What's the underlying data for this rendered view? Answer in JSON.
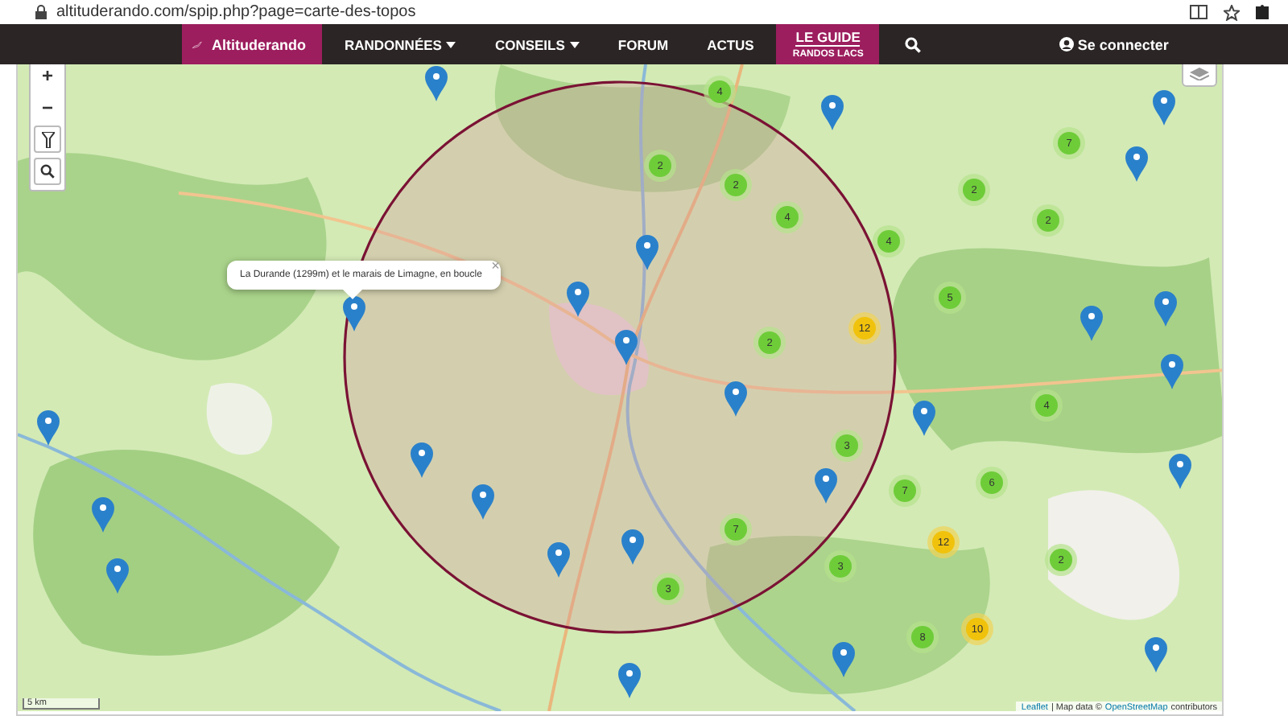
{
  "browser": {
    "url": "altituderando.com/spip.php?page=carte-des-topos"
  },
  "nav": {
    "brand": "Altituderando",
    "items": [
      {
        "label": "RANDONNÉES",
        "dropdown": true,
        "selected": false
      },
      {
        "label": "CONSEILS",
        "dropdown": true,
        "selected": false
      },
      {
        "label": "FORUM",
        "dropdown": false,
        "selected": false
      },
      {
        "label": "ACTUS",
        "dropdown": false,
        "selected": false
      },
      {
        "label": "LE GUIDE",
        "sublabel": "RANDOS LACS",
        "dropdown": false,
        "selected": true
      }
    ],
    "login": "Se connecter"
  },
  "map": {
    "zoom_in": "+",
    "zoom_out": "−",
    "popup": {
      "text": "La Durande (1299m) et le marais de Limagne, en boucle",
      "close": "×"
    },
    "clusters": [
      {
        "count": "4",
        "kind": "small"
      },
      {
        "count": "2",
        "kind": "small"
      },
      {
        "count": "2",
        "kind": "small"
      },
      {
        "count": "4",
        "kind": "small"
      },
      {
        "count": "4",
        "kind": "small"
      },
      {
        "count": "2",
        "kind": "small"
      },
      {
        "count": "12",
        "kind": "medium"
      },
      {
        "count": "5",
        "kind": "small"
      },
      {
        "count": "2",
        "kind": "small"
      },
      {
        "count": "2",
        "kind": "small"
      },
      {
        "count": "7",
        "kind": "small"
      },
      {
        "count": "3",
        "kind": "small"
      },
      {
        "count": "7",
        "kind": "small"
      },
      {
        "count": "3",
        "kind": "small"
      },
      {
        "count": "3",
        "kind": "small"
      },
      {
        "count": "7",
        "kind": "small"
      },
      {
        "count": "6",
        "kind": "small"
      },
      {
        "count": "4",
        "kind": "small"
      },
      {
        "count": "12",
        "kind": "medium"
      },
      {
        "count": "2",
        "kind": "small"
      },
      {
        "count": "8",
        "kind": "small"
      },
      {
        "count": "10",
        "kind": "medium"
      }
    ],
    "scale": "5 km",
    "attribution": {
      "leaflet": "Leaflet",
      "text": "| Map data ©",
      "osm": "OpenStreetMap",
      "suffix": "contributors"
    }
  }
}
